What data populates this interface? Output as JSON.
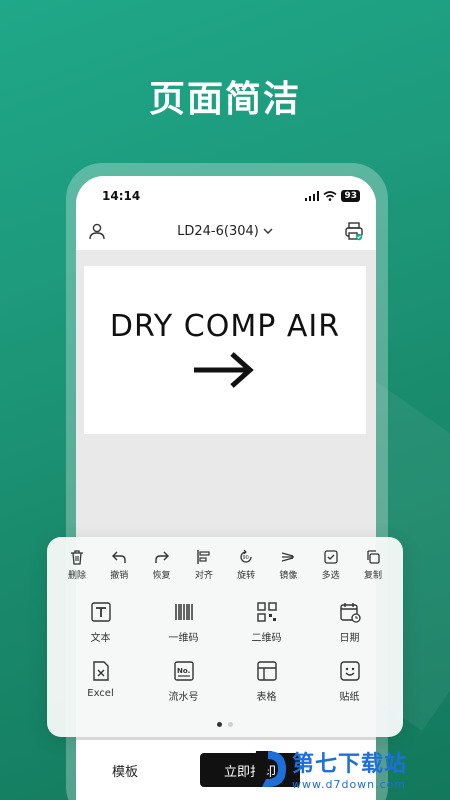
{
  "headline": "页面简洁",
  "status_bar": {
    "time": "14:14",
    "battery": "93"
  },
  "app_bar": {
    "device_name": "LD24-6(304)"
  },
  "label": {
    "text": "DRY COMP AIR"
  },
  "toolbar": [
    {
      "label": "删除",
      "icon": "trash-icon"
    },
    {
      "label": "撤销",
      "icon": "undo-icon"
    },
    {
      "label": "恢复",
      "icon": "redo-icon"
    },
    {
      "label": "对齐",
      "icon": "align-icon"
    },
    {
      "label": "旋转",
      "icon": "rotate-icon"
    },
    {
      "label": "镜像",
      "icon": "mirror-icon"
    },
    {
      "label": "多选",
      "icon": "multi-select-icon"
    },
    {
      "label": "复制",
      "icon": "copy-icon"
    }
  ],
  "elements": [
    {
      "label": "文本",
      "icon": "text-icon"
    },
    {
      "label": "一维码",
      "icon": "barcode-icon"
    },
    {
      "label": "二维码",
      "icon": "qrcode-icon"
    },
    {
      "label": "日期",
      "icon": "calendar-icon"
    },
    {
      "label": "Excel",
      "icon": "excel-icon"
    },
    {
      "label": "流水号",
      "icon": "serial-number-icon"
    },
    {
      "label": "表格",
      "icon": "table-icon"
    },
    {
      "label": "贴纸",
      "icon": "sticker-icon"
    }
  ],
  "bottom_bar": {
    "template_label": "模板",
    "print_label": "立即打印"
  },
  "watermark": {
    "name": "第七下载站",
    "url": "www.d7down.com"
  },
  "colors": {
    "accent": "#1fa889",
    "watermark": "#1e6fd9"
  }
}
